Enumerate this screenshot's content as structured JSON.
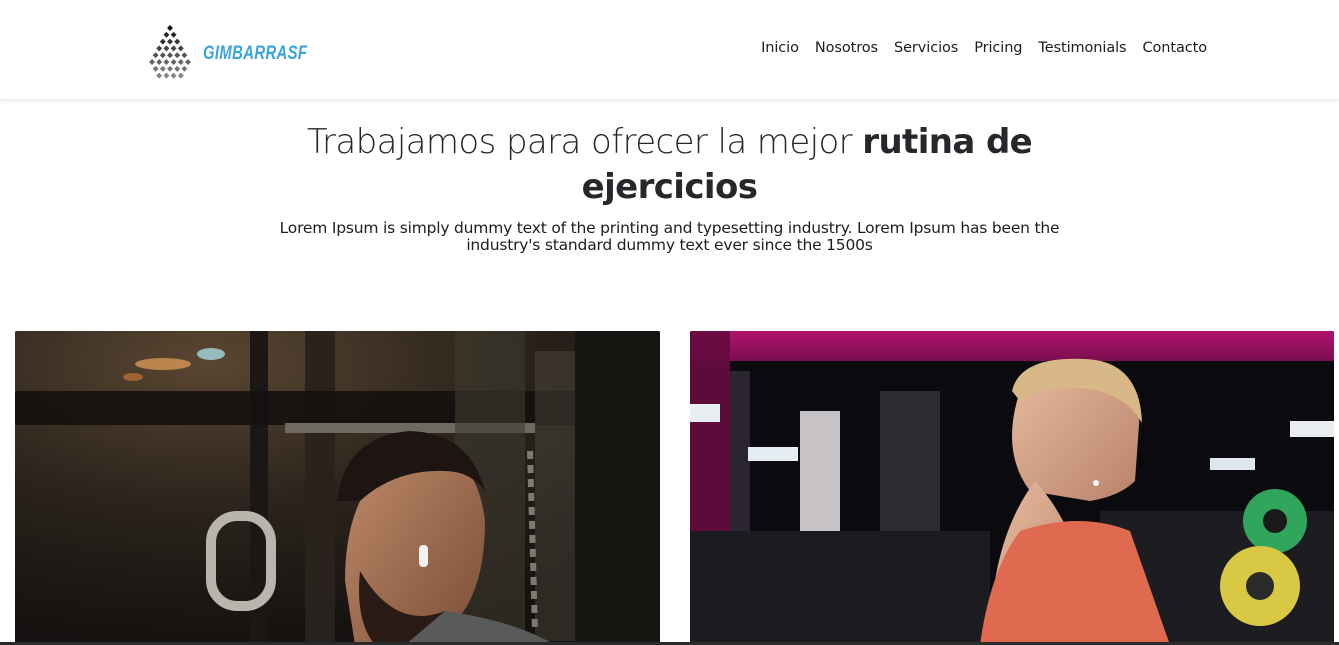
{
  "brand": {
    "name": "GIMBARRASF",
    "logo_icon": "diamond-dots-logo-icon",
    "accent_color": "#3aa3dc"
  },
  "nav": {
    "items": [
      "Inicio",
      "Nosotros",
      "Servicios",
      "Pricing",
      "Testimonials",
      "Contacto"
    ]
  },
  "hero": {
    "title_light": "Trabajamos para ofrecer la mejor ",
    "title_bold": "rutina de ejercicios",
    "subtitle": "Lorem Ipsum is simply dummy text of the printing and typesetting industry. Lorem Ipsum has been the industry's standard dummy text ever since the 1500s"
  },
  "cards": [
    {
      "image": "man-with-earbuds-at-gym-photo"
    },
    {
      "image": "blond-man-in-red-tank-top-gym-photo"
    }
  ]
}
